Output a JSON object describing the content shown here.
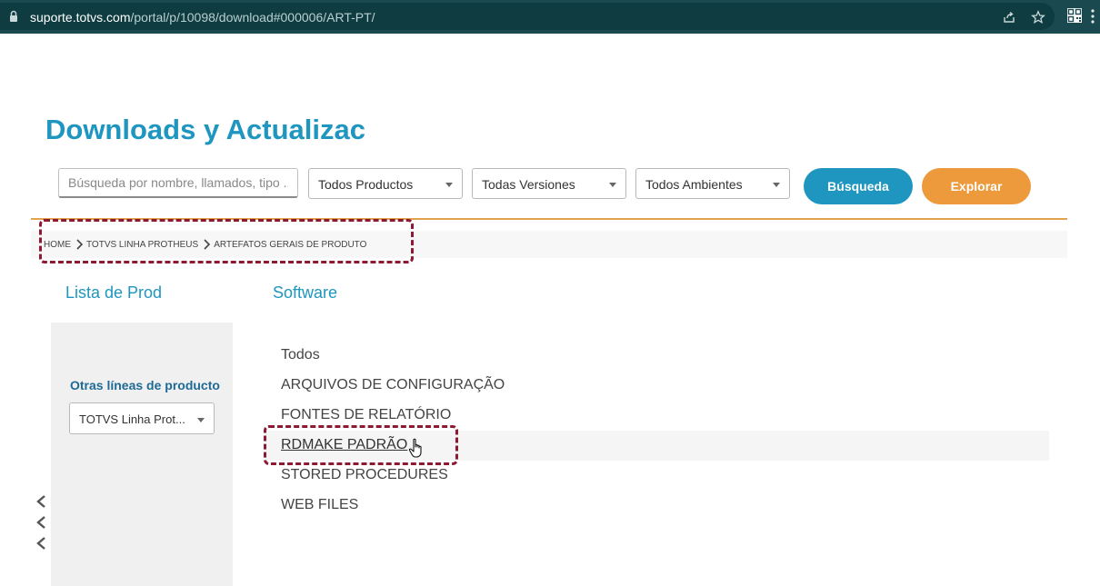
{
  "browser": {
    "url_host": "suporte.totvs.com",
    "url_path": "/portal/p/10098/download#000006/ART-PT/"
  },
  "page": {
    "title": "Downloads y Actualizac"
  },
  "search": {
    "placeholder": "Búsqueda por nombre, llamados, tipo ...",
    "filters": [
      {
        "value": "Todos Productos"
      },
      {
        "value": "Todas Versiones"
      },
      {
        "value": "Todos Ambientes"
      }
    ],
    "search_button": "Búsqueda",
    "explore_button": "Explorar"
  },
  "breadcrumb": [
    "HOME",
    "TOTVS LINHA PROTHEUS",
    "ARTEFATOS GERAIS DE PRODUTO"
  ],
  "sidebar": {
    "heading": "Lista de Prod",
    "other_lines_label": "Otras líneas de producto",
    "product_line_value": "TOTVS Linha Prot..."
  },
  "main": {
    "heading": "Software",
    "items": [
      "Todos",
      "ARQUIVOS DE CONFIGURAÇÃO",
      "FONTES DE RELATÓRIO",
      "RDMAKE PADRÃO",
      "STORED PROCEDURES",
      "WEB FILES"
    ],
    "active_index": 3
  },
  "colors": {
    "accent_blue": "#1e96c0",
    "accent_orange": "#ec9a3c",
    "highlight_dashed": "#8b1a32"
  }
}
